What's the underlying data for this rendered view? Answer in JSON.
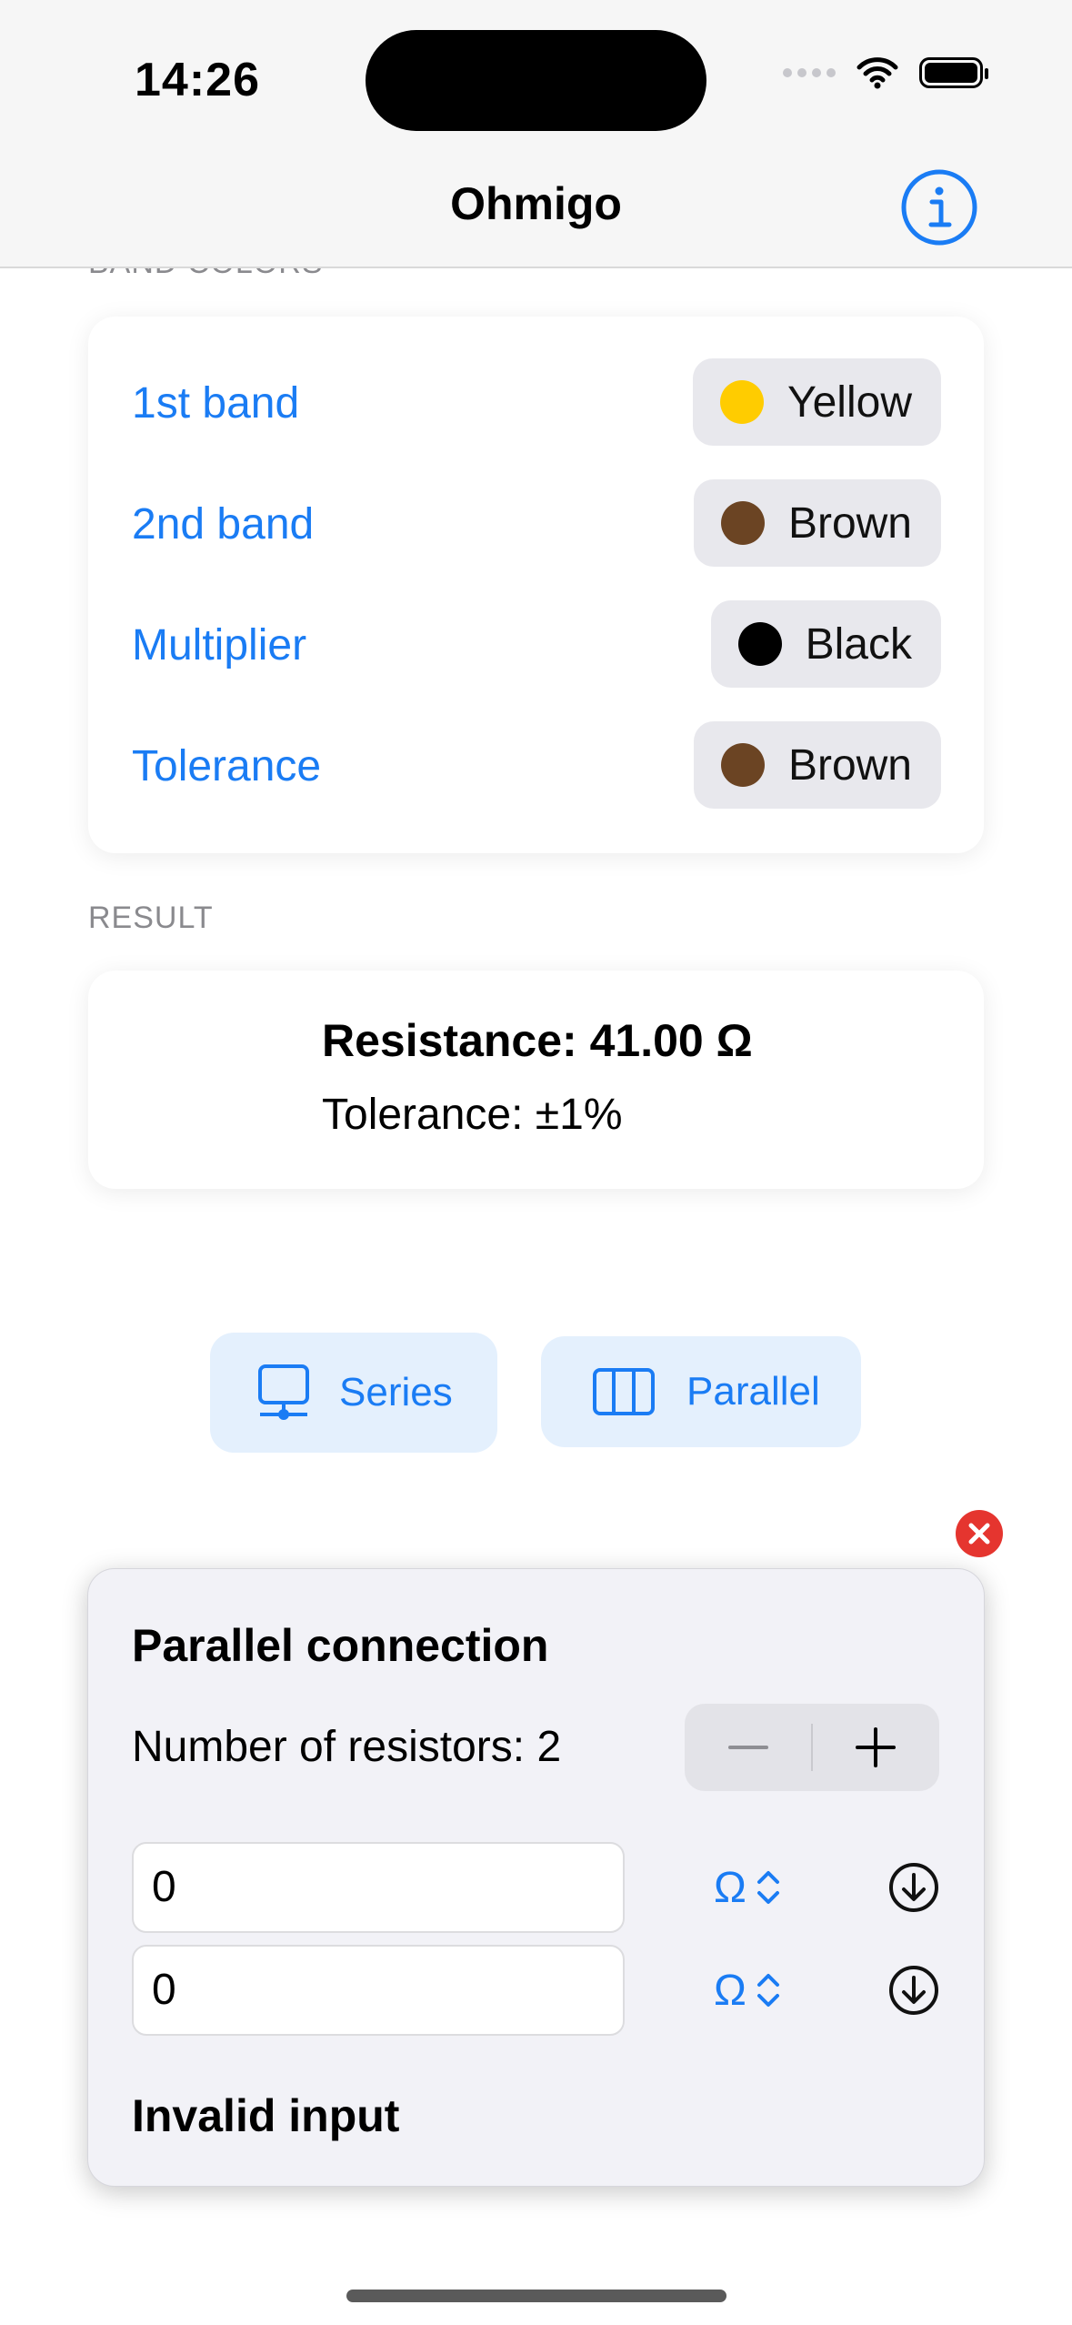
{
  "status_bar": {
    "time": "14:26"
  },
  "nav": {
    "title": "Ohmigo",
    "info_icon": "info-circle-icon"
  },
  "band_colors": {
    "header": "BAND COLORS",
    "rows": [
      {
        "label": "1st band",
        "color_name": "Yellow",
        "color": "#ffcc00"
      },
      {
        "label": "2nd band",
        "color_name": "Brown",
        "color": "#6b4423"
      },
      {
        "label": "Multiplier",
        "color_name": "Black",
        "color": "#000000"
      },
      {
        "label": "Tolerance",
        "color_name": "Brown",
        "color": "#6b4423"
      }
    ]
  },
  "result": {
    "header": "RESULT",
    "resistance": "Resistance: 41.00 Ω",
    "tolerance": "Tolerance: ±1%"
  },
  "modes": {
    "series_label": "Series",
    "parallel_label": "Parallel"
  },
  "parallel_panel": {
    "title": "Parallel connection",
    "count_label": "Number of resistors: 2",
    "inputs": [
      {
        "value": "0",
        "unit": "Ω"
      },
      {
        "value": "0",
        "unit": "Ω"
      }
    ],
    "error": "Invalid input"
  },
  "colors": {
    "accent": "#1a7cf4",
    "close": "#e5352f"
  }
}
